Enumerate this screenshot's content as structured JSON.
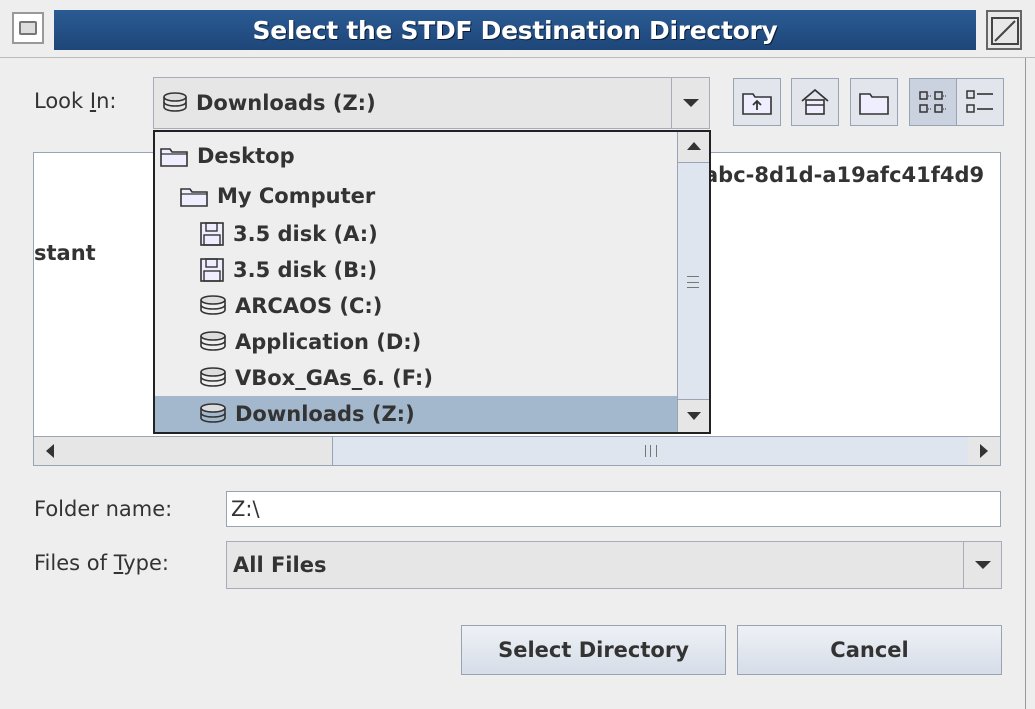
{
  "window": {
    "title": "Select the STDF Destination Directory"
  },
  "look_in": {
    "label_prefix": "Look ",
    "label_mnemonic": "I",
    "label_suffix": "n:",
    "selected": "Downloads (Z:)"
  },
  "popup_items": [
    {
      "label": "Desktop",
      "icon": "folder-icon"
    },
    {
      "label": "My Computer",
      "icon": "folder-icon"
    },
    {
      "label": "3.5 disk (A:)",
      "icon": "floppy-icon"
    },
    {
      "label": "3.5 disk (B:)",
      "icon": "floppy-icon"
    },
    {
      "label": "ARCAOS (C:)",
      "icon": "drive-icon"
    },
    {
      "label": "Application (D:)",
      "icon": "drive-icon"
    },
    {
      "label": "VBox_GAs_6. (F:)",
      "icon": "drive-icon"
    },
    {
      "label": "Downloads (Z:)",
      "icon": "drive-icon",
      "selected": true
    }
  ],
  "file_list": {
    "partial_left": "stant",
    "partial_right": "abc-8d1d-a19afc41f4d9"
  },
  "folder_name": {
    "label": "Folder name:",
    "value": "Z:\\"
  },
  "files_of_type": {
    "label_prefix": "Files of ",
    "label_mnemonic": "T",
    "label_suffix": "ype:",
    "value": "All Files"
  },
  "buttons": {
    "select": "Select Directory",
    "cancel": "Cancel"
  }
}
